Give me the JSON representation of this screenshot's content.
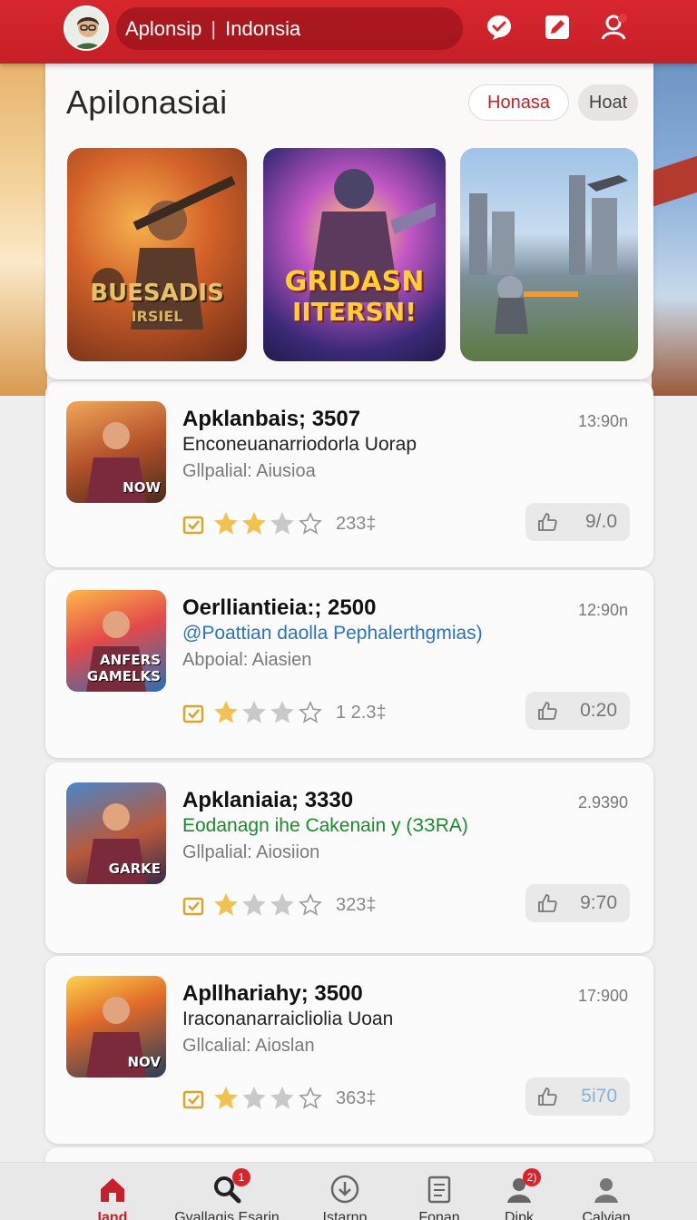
{
  "header": {
    "app_name": "Aplonsip",
    "region": "Indonsia",
    "colors": {
      "brand": "#d8262d",
      "accent_blue": "#2a73c4",
      "accent_green": "#1c8a2c"
    }
  },
  "hero": {
    "title": "Apilonasiai",
    "chips": [
      "Honasa",
      "Hoat"
    ],
    "features": [
      {
        "caption": "BUESADIS",
        "caption2": "IRSIEL"
      },
      {
        "caption": "GRIDASN",
        "caption2": "IITERSN!"
      },
      {
        "caption": ""
      }
    ]
  },
  "apps": [
    {
      "title": "Apklanbais; 3507",
      "subtitle": "Enconeuanarriodorla Uorap",
      "subtitle_color": "#222222",
      "meta": "Gllpalial: Aiusioa",
      "time": "13:90n",
      "rating": 2,
      "count": "233‡",
      "likes": "9/.0",
      "icon_tag": "NOW"
    },
    {
      "title": "Oerlliantieia:; 2500",
      "subtitle": "@Poattian daolla Pephalerthgmias)",
      "subtitle_color": "#2a73c4",
      "meta": "Abpoial: Aiasien",
      "time": "12:90n",
      "rating": 1,
      "count": "1 2.3‡",
      "likes": "0:20",
      "icon_tag": "ANFERS GAMELKS"
    },
    {
      "title": "Apklaniaia; 3330",
      "subtitle": "Eodanagn ihe Cakenain y (ЗЗRА)",
      "subtitle_color": "#1c8a2c",
      "meta": "Gllpalial: Aiosiion",
      "time": "2.9390",
      "rating": 1,
      "count": "323‡",
      "likes": "9:70",
      "icon_tag": "GARKE"
    },
    {
      "title": "Apllhariahy; 3500",
      "subtitle": "Iraconanarraicliolia Uoan",
      "subtitle_color": "#222222",
      "meta": "Gllcalial: Aioslan",
      "time": "17:900",
      "rating": 1,
      "count": "363‡",
      "likes": "5i70",
      "icon_tag": "NOV"
    }
  ],
  "nav": [
    {
      "label": "Iand",
      "icon": "home-icon",
      "badge": ""
    },
    {
      "label": "Gvallagis Esarin",
      "icon": "search-icon",
      "badge": "1"
    },
    {
      "label": "Istarnp",
      "icon": "download-icon",
      "badge": ""
    },
    {
      "label": "Fonan",
      "icon": "document-icon",
      "badge": ""
    },
    {
      "label": "Dipk",
      "icon": "user-icon",
      "badge": "2)"
    },
    {
      "label": "Calvian",
      "icon": "profile-icon",
      "badge": ""
    }
  ]
}
